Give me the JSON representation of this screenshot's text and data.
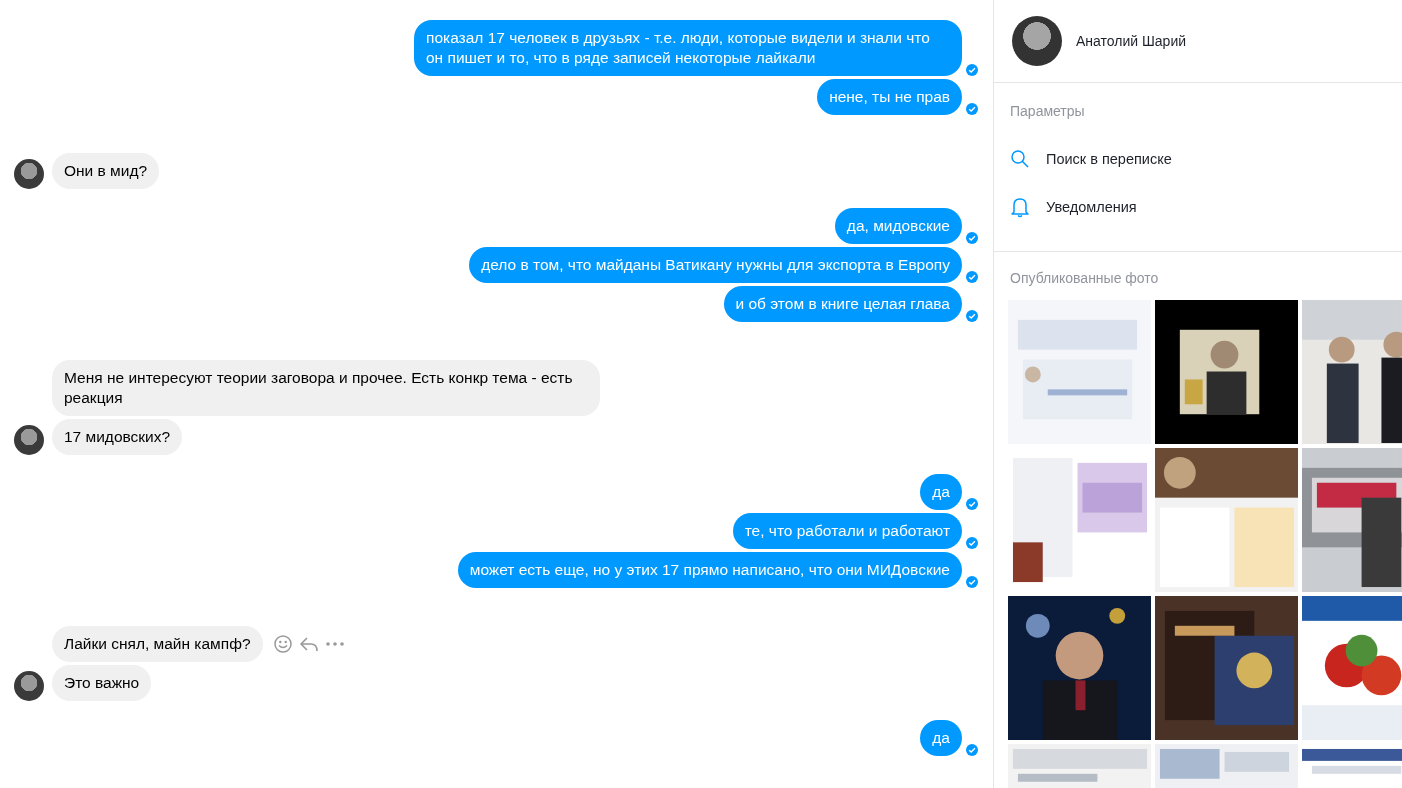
{
  "messages": [
    {
      "kind": "outgoing",
      "text": "показал 17 человек в друзьях - т.е. люди, которые видели и знали что он пишет и то, что в ряде записей некоторые лайкали",
      "new_group": true,
      "read": true
    },
    {
      "kind": "outgoing",
      "text": "нене, ты не прав",
      "new_group": false,
      "read": true
    },
    {
      "kind": "incoming",
      "text": "Они в мид?",
      "new_group": true,
      "avatar": true
    },
    {
      "kind": "outgoing",
      "text": "да, мидовские",
      "new_group": true,
      "read": true
    },
    {
      "kind": "outgoing",
      "text": "дело в том, что майданы Ватикану нужны для экспорта в Европу",
      "new_group": false,
      "read": true
    },
    {
      "kind": "outgoing",
      "text": "и об этом в книге целая глава",
      "new_group": false,
      "read": true
    },
    {
      "kind": "incoming",
      "text": "Меня не интересуют теории заговора и прочее. Есть конкр тема - есть реакция",
      "new_group": true,
      "avatar": false
    },
    {
      "kind": "incoming",
      "text": "17 мидовских?",
      "new_group": false,
      "avatar": true
    },
    {
      "kind": "outgoing",
      "text": "да",
      "new_group": true,
      "read": true
    },
    {
      "kind": "outgoing",
      "text": "те, что работали и работают",
      "new_group": false,
      "read": true
    },
    {
      "kind": "outgoing",
      "text": "может есть еще, но у этих 17 прямо написано, что они МИДовские",
      "new_group": false,
      "read": true
    },
    {
      "kind": "incoming",
      "text": "Лайки снял, майн кампф?",
      "new_group": true,
      "avatar": false,
      "hover_actions": true
    },
    {
      "kind": "incoming",
      "text": "Это важно",
      "new_group": false,
      "avatar": true
    },
    {
      "kind": "outgoing",
      "text": "да",
      "new_group": true,
      "read": true
    }
  ],
  "contact": {
    "name": "Анатолий Шарий"
  },
  "options_heading": "Параметры",
  "options": [
    {
      "kind": "search",
      "label": "Поиск в переписке"
    },
    {
      "kind": "bell",
      "label": "Уведомления"
    }
  ],
  "photos_heading": "Опубликованные фото"
}
